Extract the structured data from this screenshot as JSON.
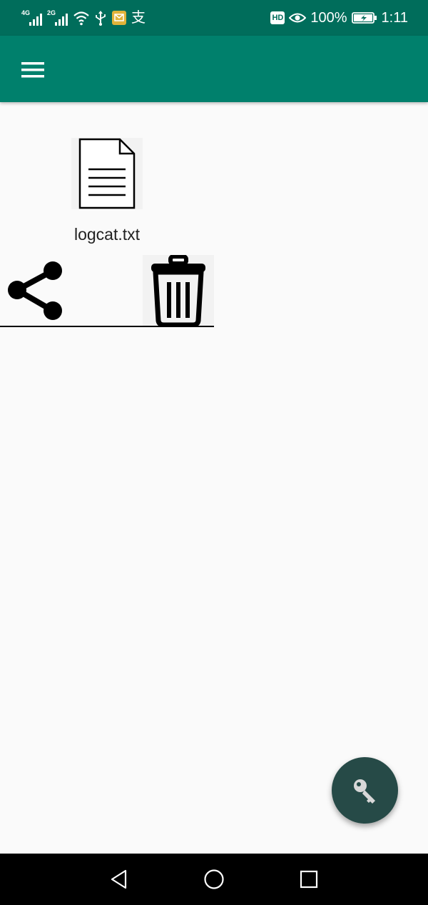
{
  "status_bar": {
    "network1": "4G",
    "network2": "2G",
    "battery_percent": "100%",
    "time": "1:11",
    "hd_label": "HD",
    "alipay_glyph": "支",
    "icons": [
      "signal-icon",
      "wifi-icon",
      "usb-icon",
      "notification-icon",
      "eye-icon",
      "battery-icon"
    ]
  },
  "app_bar": {
    "menu_icon": "menu-icon"
  },
  "files": [
    {
      "name": "logcat.txt",
      "icon": "document-icon",
      "actions": [
        "share-icon",
        "trash-icon"
      ]
    }
  ],
  "fab": {
    "icon": "key-icon"
  },
  "nav_bar": {
    "icons": [
      "back-icon",
      "home-icon",
      "recents-icon"
    ]
  },
  "colors": {
    "status_bar": "#006d5b",
    "app_bar": "#00806c",
    "background": "#fafafa",
    "fab": "#264a47",
    "nav_bar": "#000000"
  }
}
